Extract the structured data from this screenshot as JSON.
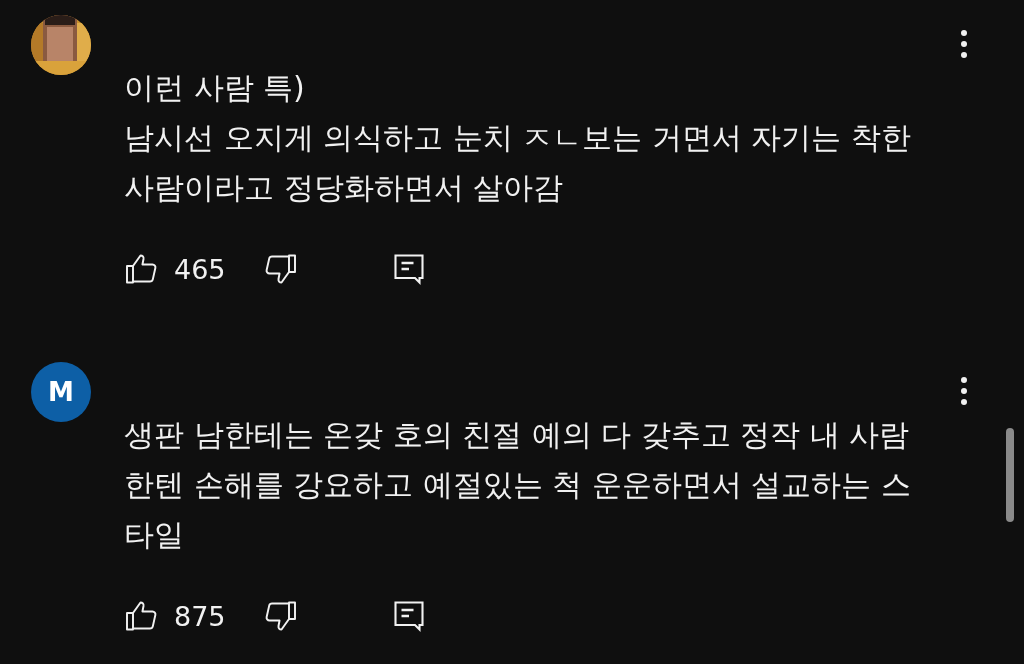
{
  "comments": [
    {
      "text": "이런 사람 특)\n남시선 오지게 의식하고 눈치 ㅈㄴ보는 거면서 자기는 착한\n사람이라고 정당화하면서 살아감",
      "likes": "465"
    },
    {
      "avatar": {
        "kind": "letter",
        "letter": "M",
        "color": "#0d5fa6"
      },
      "text": "생판 남한테는 온갖 호의 친절 예의 다 갖추고 정작 내 사람\n한텐 손해를 강요하고 예절있는 척 운운하면서 설교하는 스\n타일",
      "likes": "875"
    }
  ]
}
